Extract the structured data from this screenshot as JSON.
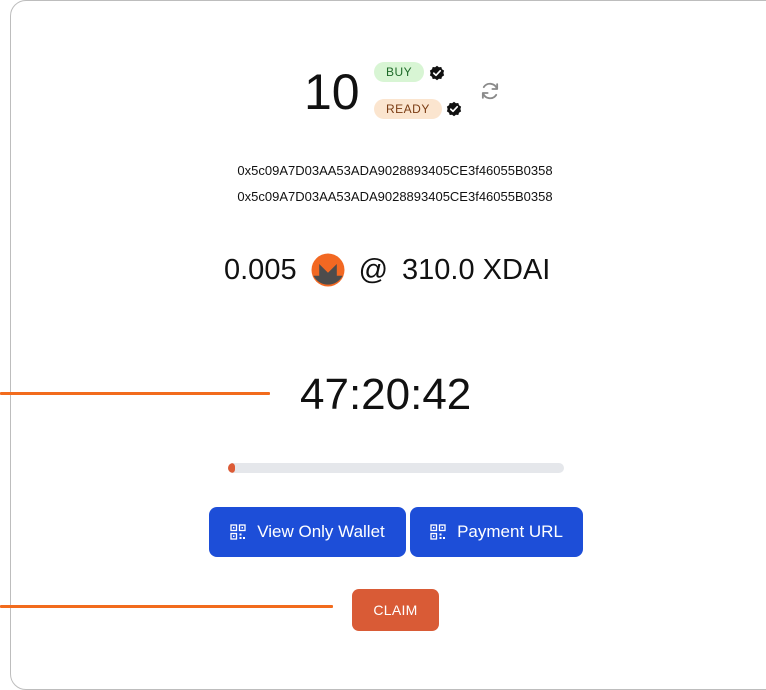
{
  "order": {
    "number": "10",
    "badge_buy": "BUY",
    "badge_ready": "READY"
  },
  "addresses": [
    "0x5c09A7D03AA53ADA9028893405CE3f46055B0358",
    "0x5c09A7D03AA53ADA9028893405CE3f46055B0358"
  ],
  "price": {
    "amount": "0.005",
    "at_symbol": "@",
    "total": "310.0 XDAI"
  },
  "timer": {
    "value": "47:20:42"
  },
  "progress": {
    "fraction": 0.02
  },
  "buttons": {
    "view_only_wallet": "View Only Wallet",
    "payment_url": "Payment URL",
    "claim": "CLAIM"
  },
  "icons": {
    "verified": "check-badge-icon",
    "refresh": "refresh-icon",
    "currency": "monero-icon",
    "qr": "qr-code-icon"
  },
  "colors": {
    "accent_blue": "#1d4ed8",
    "claim": "#d95b36",
    "annotation": "#f26b1d",
    "buy_badge_bg": "#d8f5d4",
    "ready_badge_bg": "#fbe5cf",
    "progress_fill": "#dc5b36",
    "progress_track": "#e5e7eb"
  }
}
